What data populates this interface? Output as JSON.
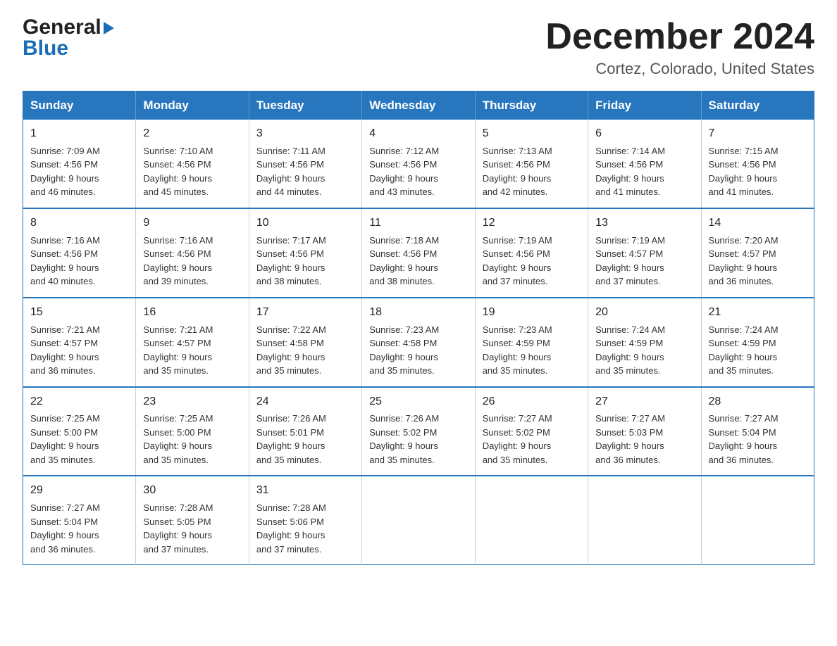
{
  "header": {
    "logo_general": "General",
    "logo_blue": "Blue",
    "main_title": "December 2024",
    "subtitle": "Cortez, Colorado, United States"
  },
  "calendar": {
    "days_of_week": [
      "Sunday",
      "Monday",
      "Tuesday",
      "Wednesday",
      "Thursday",
      "Friday",
      "Saturday"
    ],
    "weeks": [
      [
        {
          "day": "1",
          "sunrise": "7:09 AM",
          "sunset": "4:56 PM",
          "daylight": "9 hours and 46 minutes."
        },
        {
          "day": "2",
          "sunrise": "7:10 AM",
          "sunset": "4:56 PM",
          "daylight": "9 hours and 45 minutes."
        },
        {
          "day": "3",
          "sunrise": "7:11 AM",
          "sunset": "4:56 PM",
          "daylight": "9 hours and 44 minutes."
        },
        {
          "day": "4",
          "sunrise": "7:12 AM",
          "sunset": "4:56 PM",
          "daylight": "9 hours and 43 minutes."
        },
        {
          "day": "5",
          "sunrise": "7:13 AM",
          "sunset": "4:56 PM",
          "daylight": "9 hours and 42 minutes."
        },
        {
          "day": "6",
          "sunrise": "7:14 AM",
          "sunset": "4:56 PM",
          "daylight": "9 hours and 41 minutes."
        },
        {
          "day": "7",
          "sunrise": "7:15 AM",
          "sunset": "4:56 PM",
          "daylight": "9 hours and 41 minutes."
        }
      ],
      [
        {
          "day": "8",
          "sunrise": "7:16 AM",
          "sunset": "4:56 PM",
          "daylight": "9 hours and 40 minutes."
        },
        {
          "day": "9",
          "sunrise": "7:16 AM",
          "sunset": "4:56 PM",
          "daylight": "9 hours and 39 minutes."
        },
        {
          "day": "10",
          "sunrise": "7:17 AM",
          "sunset": "4:56 PM",
          "daylight": "9 hours and 38 minutes."
        },
        {
          "day": "11",
          "sunrise": "7:18 AM",
          "sunset": "4:56 PM",
          "daylight": "9 hours and 38 minutes."
        },
        {
          "day": "12",
          "sunrise": "7:19 AM",
          "sunset": "4:56 PM",
          "daylight": "9 hours and 37 minutes."
        },
        {
          "day": "13",
          "sunrise": "7:19 AM",
          "sunset": "4:57 PM",
          "daylight": "9 hours and 37 minutes."
        },
        {
          "day": "14",
          "sunrise": "7:20 AM",
          "sunset": "4:57 PM",
          "daylight": "9 hours and 36 minutes."
        }
      ],
      [
        {
          "day": "15",
          "sunrise": "7:21 AM",
          "sunset": "4:57 PM",
          "daylight": "9 hours and 36 minutes."
        },
        {
          "day": "16",
          "sunrise": "7:21 AM",
          "sunset": "4:57 PM",
          "daylight": "9 hours and 35 minutes."
        },
        {
          "day": "17",
          "sunrise": "7:22 AM",
          "sunset": "4:58 PM",
          "daylight": "9 hours and 35 minutes."
        },
        {
          "day": "18",
          "sunrise": "7:23 AM",
          "sunset": "4:58 PM",
          "daylight": "9 hours and 35 minutes."
        },
        {
          "day": "19",
          "sunrise": "7:23 AM",
          "sunset": "4:59 PM",
          "daylight": "9 hours and 35 minutes."
        },
        {
          "day": "20",
          "sunrise": "7:24 AM",
          "sunset": "4:59 PM",
          "daylight": "9 hours and 35 minutes."
        },
        {
          "day": "21",
          "sunrise": "7:24 AM",
          "sunset": "4:59 PM",
          "daylight": "9 hours and 35 minutes."
        }
      ],
      [
        {
          "day": "22",
          "sunrise": "7:25 AM",
          "sunset": "5:00 PM",
          "daylight": "9 hours and 35 minutes."
        },
        {
          "day": "23",
          "sunrise": "7:25 AM",
          "sunset": "5:00 PM",
          "daylight": "9 hours and 35 minutes."
        },
        {
          "day": "24",
          "sunrise": "7:26 AM",
          "sunset": "5:01 PM",
          "daylight": "9 hours and 35 minutes."
        },
        {
          "day": "25",
          "sunrise": "7:26 AM",
          "sunset": "5:02 PM",
          "daylight": "9 hours and 35 minutes."
        },
        {
          "day": "26",
          "sunrise": "7:27 AM",
          "sunset": "5:02 PM",
          "daylight": "9 hours and 35 minutes."
        },
        {
          "day": "27",
          "sunrise": "7:27 AM",
          "sunset": "5:03 PM",
          "daylight": "9 hours and 36 minutes."
        },
        {
          "day": "28",
          "sunrise": "7:27 AM",
          "sunset": "5:04 PM",
          "daylight": "9 hours and 36 minutes."
        }
      ],
      [
        {
          "day": "29",
          "sunrise": "7:27 AM",
          "sunset": "5:04 PM",
          "daylight": "9 hours and 36 minutes."
        },
        {
          "day": "30",
          "sunrise": "7:28 AM",
          "sunset": "5:05 PM",
          "daylight": "9 hours and 37 minutes."
        },
        {
          "day": "31",
          "sunrise": "7:28 AM",
          "sunset": "5:06 PM",
          "daylight": "9 hours and 37 minutes."
        },
        null,
        null,
        null,
        null
      ]
    ],
    "labels": {
      "sunrise": "Sunrise: ",
      "sunset": "Sunset: ",
      "daylight": "Daylight: "
    }
  }
}
